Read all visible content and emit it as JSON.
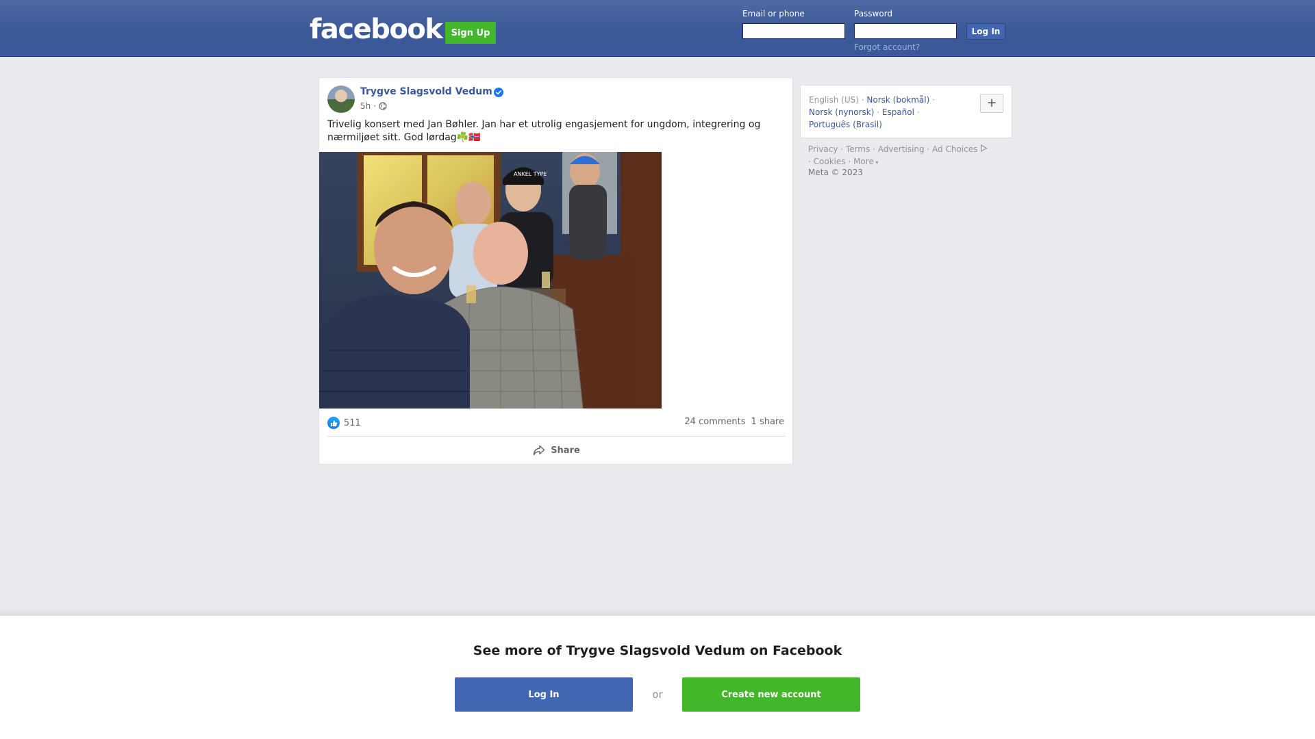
{
  "header": {
    "logo": "facebook",
    "signup_label": "Sign Up",
    "email_label": "Email or phone",
    "email_value": "",
    "password_label": "Password",
    "password_value": "",
    "login_label": "Log In",
    "forgot_label": "Forgot account?"
  },
  "post": {
    "author": "Trygve Slagsvold Vedum",
    "verified": true,
    "time": "5h",
    "audience_icon": "globe-icon",
    "text": "Trivelig konsert med Jan Bøhler. Jan har et utrolig engasjement for ungdom, integrering og nærmiljøet sitt. God lørdag☘️🇳🇴",
    "reaction_count": "511",
    "comments": "24 comments",
    "shares": "1 share",
    "share_label": "Share",
    "photo_caps_text": "ANKEL TYPE"
  },
  "sidebar": {
    "languages": [
      {
        "label": "English (US)",
        "current": true
      },
      {
        "label": "Norsk (bokmål)",
        "current": false
      },
      {
        "label": "Norsk (nynorsk)",
        "current": false
      },
      {
        "label": "Español",
        "current": false
      },
      {
        "label": "Português (Brasil)",
        "current": false
      }
    ],
    "add_language_label": "+",
    "footer_links": [
      "Privacy",
      "Terms",
      "Advertising",
      "Ad Choices",
      "Cookies",
      "More"
    ],
    "copyright": "Meta © 2023"
  },
  "banner": {
    "title": "See more of Trygve Slagsvold Vedum on Facebook",
    "login_label": "Log In",
    "or_label": "or",
    "create_label": "Create new account"
  },
  "colors": {
    "header_blue": "#3b5998",
    "brand_blue": "#4267b2",
    "green": "#42b72a",
    "link": "#385898"
  }
}
